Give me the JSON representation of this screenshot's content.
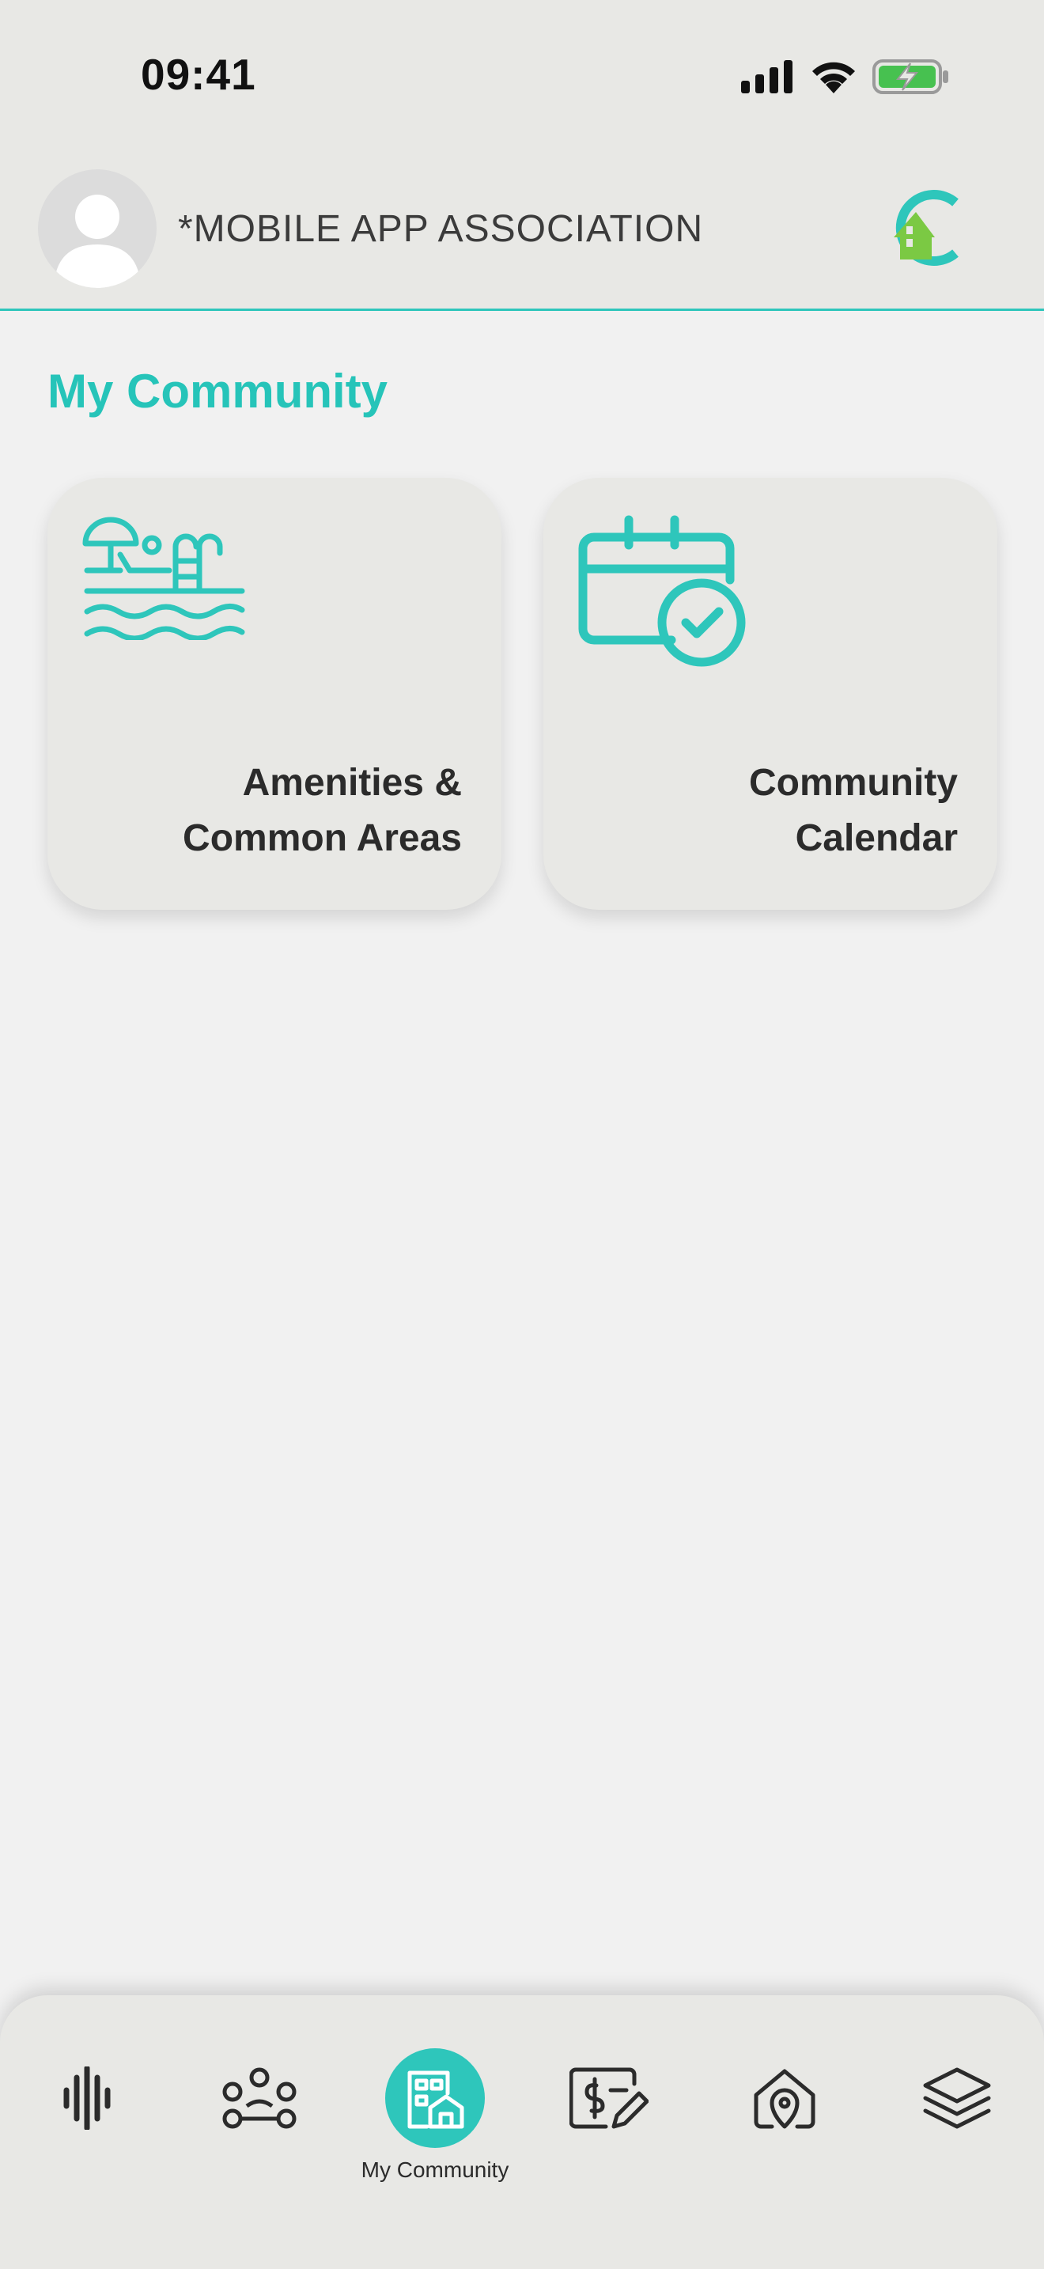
{
  "status_bar": {
    "time": "09:41",
    "icons": [
      "signal-icon",
      "wifi-icon",
      "battery-charging-icon"
    ]
  },
  "header": {
    "association_name": "*MOBILE APP ASSOCIATION",
    "avatar": "user-avatar-icon",
    "logo": "brand-logo-icon"
  },
  "main": {
    "section_title": "My Community",
    "tiles": [
      {
        "line1": "Amenities &",
        "line2": "Common Areas",
        "icon": "pool-icon"
      },
      {
        "line1": "Community",
        "line2": "Calendar",
        "icon": "calendar-check-icon"
      }
    ]
  },
  "bottom_nav": {
    "items": [
      {
        "icon": "soundwave-icon",
        "label": ""
      },
      {
        "icon": "people-network-icon",
        "label": ""
      },
      {
        "icon": "building-home-icon",
        "label": "My Community",
        "active": true
      },
      {
        "icon": "payment-edit-icon",
        "label": ""
      },
      {
        "icon": "home-location-icon",
        "label": ""
      },
      {
        "icon": "layers-icon",
        "label": ""
      }
    ]
  },
  "colors": {
    "accent": "#2ec6bb",
    "logo_green": "#7bc943",
    "background": "#f1f1f1",
    "surface": "#e8e8e5"
  }
}
